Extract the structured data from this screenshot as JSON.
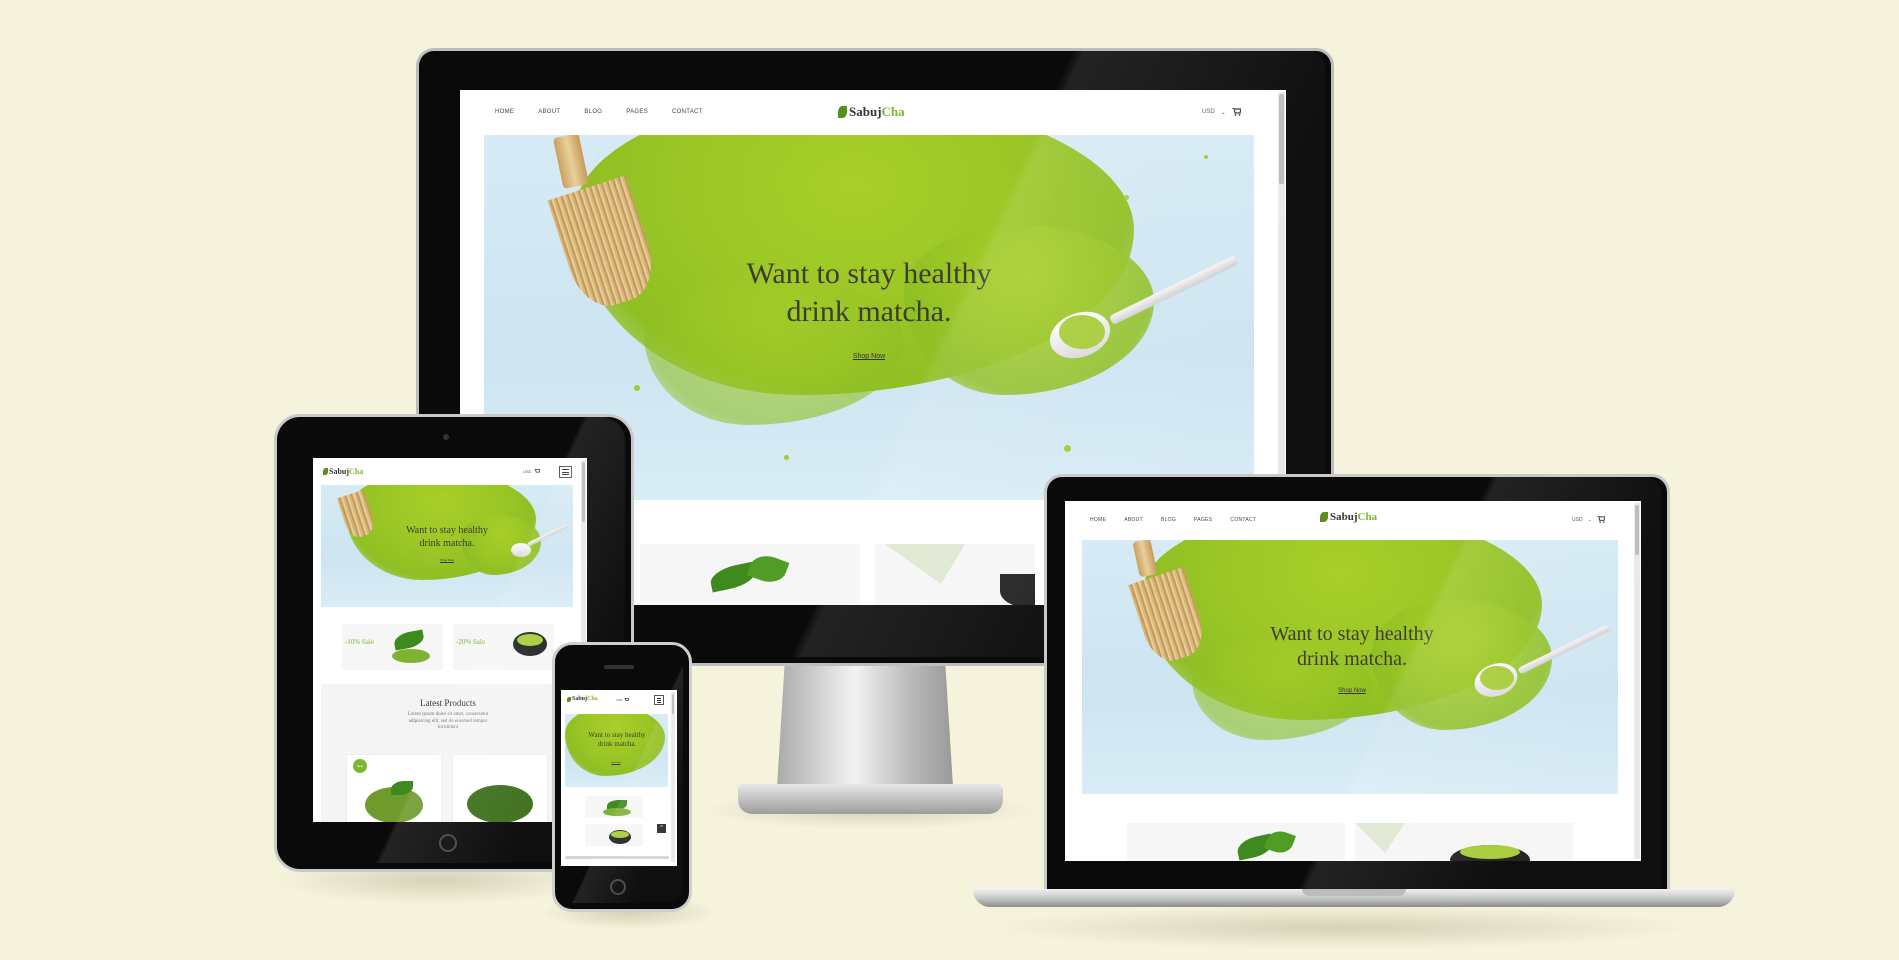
{
  "site": {
    "logo_main": "Sabuj",
    "logo_accent": "Cha",
    "menu": [
      "HOME",
      "ABOUT",
      "BLOG",
      "PAGES",
      "CONTACT"
    ],
    "currency": "USD",
    "currency_arrow": "⌄",
    "cart_icon": "shopping-cart-icon",
    "hero_line1": "Want to stay healthy",
    "hero_line2": "drink matcha.",
    "shop_now": "Shop Now"
  },
  "tablet": {
    "sale1": "-10% Sale",
    "sale2": "-20% Sale",
    "latest_title": "Latest Products",
    "latest_desc_1": "Lorem ipsum dolor sit amet, consectetur",
    "latest_desc_2": "adipisicing elit, sed do eiusmod tempor",
    "latest_desc_3": "incididunt",
    "badge": "New"
  },
  "colors": {
    "background": "#f6f3dd",
    "accent": "#7cb82f",
    "matcha": "#9cc726"
  }
}
